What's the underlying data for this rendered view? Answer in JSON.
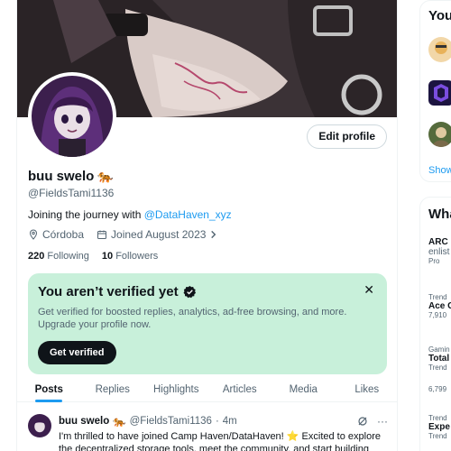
{
  "profile": {
    "display_name": "buu swelo",
    "name_emoji": "🐅",
    "handle": "@FieldsTami1136",
    "bio_prefix": "Joining the journey with ",
    "bio_mention": "@DataHaven_xyz",
    "location": "Córdoba",
    "joined": "Joined August 2023",
    "following_count": "220",
    "following_label": "Following",
    "followers_count": "10",
    "followers_label": "Followers",
    "edit_label": "Edit profile"
  },
  "verify_card": {
    "title": "You aren’t verified yet",
    "description": "Get verified for boosted replies, analytics, ad-free browsing, and more. Upgrade your profile now.",
    "button_label": "Get verified",
    "close_glyph": "✕"
  },
  "tabs": [
    {
      "label": "Posts",
      "active": true
    },
    {
      "label": "Replies",
      "active": false
    },
    {
      "label": "Highlights",
      "active": false
    },
    {
      "label": "Articles",
      "active": false
    },
    {
      "label": "Media",
      "active": false
    },
    {
      "label": "Likes",
      "active": false
    }
  ],
  "post": {
    "name": "buu swelo",
    "emoji": "🐅",
    "handle": "@FieldsTami1136",
    "separator": "·",
    "time": "4m",
    "text": "I'm thrilled to have joined Camp Haven/DataHaven! ⭐ Excited to explore the decentralized storage tools, meet the community, and start building",
    "more_glyph": "···"
  },
  "sidebar": {
    "who_to_follow_heading": "You",
    "show_more": "Show",
    "whats_happening_heading": "Wha",
    "trends": [
      {
        "category": "ARC",
        "title": "enlist",
        "count": "Pro"
      },
      {
        "category": "Trend",
        "title": "Ace C",
        "count": "7,910"
      },
      {
        "category": "Gamin",
        "title": "Total",
        "count": "Trend"
      },
      {
        "category": "6,799",
        "title": "",
        "count": ""
      },
      {
        "category": "Trend",
        "title": "Expe",
        "count": "Trend"
      }
    ]
  },
  "colors": {
    "accent": "#1d9bf0",
    "verify_bg": "#c8f0da",
    "text_primary": "#0f1419",
    "text_secondary": "#536471"
  },
  "icons": [
    "location-icon",
    "calendar-icon",
    "chevron-right-icon",
    "verified-badge-icon",
    "close-icon",
    "grok-icon",
    "more-icon"
  ]
}
